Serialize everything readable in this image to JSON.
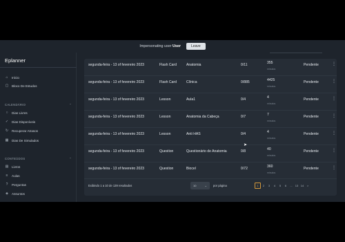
{
  "banner": {
    "text": "Impersonating user",
    "user": "User",
    "leave_label": "Leave"
  },
  "sidebar": {
    "brand": "Eplanner",
    "main_items": [
      {
        "label": "Início",
        "icon": "home-icon"
      },
      {
        "label": "Bloco De Estudos",
        "icon": "square-icon"
      }
    ],
    "calendar_section": {
      "title": "CALENDÁRIO"
    },
    "calendar_items": [
      {
        "label": "Dias Livres",
        "icon": "circle-icon"
      },
      {
        "label": "Dias Disponíveis",
        "icon": "check-icon"
      },
      {
        "label": "Recuperar Atrasos",
        "icon": "refresh-icon"
      },
      {
        "label": "Dias De Simulados",
        "icon": "calendar-icon"
      }
    ],
    "content_section": {
      "title": "CONTEÚDOS"
    },
    "content_items": [
      {
        "label": "Livros",
        "icon": "book-icon"
      },
      {
        "label": "Aulas",
        "icon": "list-icon"
      },
      {
        "label": "Perguntas",
        "icon": "question-icon"
      },
      {
        "label": "Assuntos",
        "icon": "tag-icon"
      }
    ]
  },
  "table": {
    "rows": [
      {
        "date": "segunda-feira - 13 of fevereiro 2023",
        "type": "Flash Card",
        "subject": "Anatomia",
        "ratio": "0/11",
        "count": "355",
        "count_sub": "minutos",
        "status": "Pendente"
      },
      {
        "date": "segunda-feira - 13 of fevereiro 2023",
        "type": "Flash Card",
        "subject": "Clínica",
        "ratio": "0/885",
        "count": "4425",
        "count_sub": "minutos",
        "status": "Pendente"
      },
      {
        "date": "segunda-feira - 13 of fevereiro 2023",
        "type": "Lesson",
        "subject": "Aula1",
        "ratio": "0/4",
        "count": "4",
        "count_sub": "minutos",
        "status": "Pendente"
      },
      {
        "date": "segunda-feira - 13 of fevereiro 2023",
        "type": "Lesson",
        "subject": "Anatomia da Cabeça",
        "ratio": "0/7",
        "count": "7",
        "count_sub": "minutos",
        "status": "Pendente"
      },
      {
        "date": "segunda-feira - 13 of fevereiro 2023",
        "type": "Lesson",
        "subject": "Anti HAS",
        "ratio": "0/4",
        "count": "4",
        "count_sub": "minutos",
        "status": "Pendente"
      },
      {
        "date": "segunda-feira - 13 of fevereiro 2023",
        "type": "Question",
        "subject": "Questionário de Anatomia",
        "ratio": "0/8",
        "count": "40",
        "count_sub": "minutos",
        "status": "Pendente"
      },
      {
        "date": "segunda-feira - 13 of fevereiro 2023",
        "type": "Question",
        "subject": "Biocel",
        "ratio": "0/72",
        "count": "360",
        "count_sub": "minutos",
        "status": "Pendente"
      }
    ],
    "kebab": "⋮"
  },
  "footer": {
    "results_text": "Exibindo 1 a 10 de 139 resultados",
    "per_page_value": "10",
    "per_page_label": "por página",
    "pages": [
      "1",
      "2",
      "3",
      "4",
      "5",
      "6",
      "...",
      "13",
      "14",
      ">"
    ],
    "active_page": "1"
  },
  "colors": {
    "background": "#1e242c",
    "panel": "#262d36",
    "accent": "#d79a3b"
  }
}
